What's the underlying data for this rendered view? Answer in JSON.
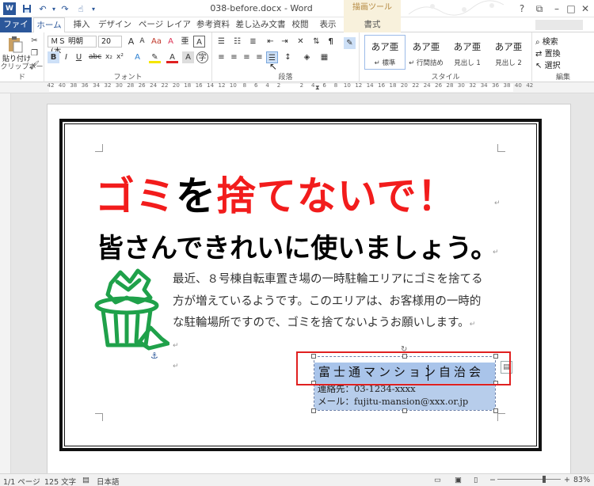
{
  "title_bar": {
    "doc_title": "038-before.docx - Word",
    "context_tab_group": "描画ツール",
    "quick_access": [
      "save-icon",
      "undo-icon",
      "redo-icon",
      "touch-mode-icon",
      "customize-icon"
    ],
    "window_buttons": [
      "?",
      "⧉",
      "–",
      "□",
      "✕"
    ]
  },
  "tabs": {
    "file": "ファイル",
    "home": "ホーム",
    "insert": "挿入",
    "design": "デザイン",
    "page_layout": "ページ レイアウト",
    "references": "参考資料",
    "mailings": "差し込み文書",
    "review": "校閲",
    "view": "表示",
    "format": "書式"
  },
  "ribbon": {
    "clipboard": {
      "paste": "貼り付け",
      "label": "クリップボード"
    },
    "font": {
      "name": "ＭＳ 明朝 (本",
      "size": "20",
      "label": "フォント"
    },
    "paragraph": {
      "label": "段落"
    },
    "styles": {
      "label": "スタイル",
      "items": [
        {
          "sample": "あア亜",
          "name": "↵ 標準"
        },
        {
          "sample": "あア亜",
          "name": "↵ 行間詰め"
        },
        {
          "sample": "あア亜",
          "name": "見出し 1"
        },
        {
          "sample": "あア亜",
          "name": "見出し 2"
        }
      ]
    },
    "editing": {
      "find": "検索",
      "replace": "置換",
      "select": "選択",
      "label": "編集"
    }
  },
  "ruler": {
    "numbers": [
      "42",
      "40",
      "38",
      "36",
      "34",
      "32",
      "30",
      "28",
      "26",
      "24",
      "22",
      "20",
      "18",
      "16",
      "14",
      "12",
      "10",
      "8",
      "6",
      "4",
      "2",
      "",
      "2",
      "4",
      "6",
      "8",
      "10",
      "12",
      "14",
      "16",
      "18",
      "20",
      "22",
      "24",
      "26",
      "28",
      "30",
      "32",
      "34",
      "36",
      "38",
      "40",
      "42"
    ]
  },
  "document": {
    "heading1_parts": [
      {
        "text": "ゴミ",
        "color": "#f21c1c"
      },
      {
        "text": "を",
        "color": "#000000"
      },
      {
        "text": "捨てないで！",
        "color": "#f21c1c"
      }
    ],
    "heading2": "皆さんできれいに使いましょう。",
    "body_lines": [
      "最近、８号棟自転車置き場の一時駐輪エリアにゴミを捨てる",
      "方が増えているようです。このエリアは、お客様用の一時的",
      "な駐輪場所ですので、ゴミを捨てないようお願いします。"
    ],
    "textbox": {
      "title": "富士通マンション自治会",
      "contact": "連絡先：03-1234-xxxx",
      "email": "メール：fujitu-mansion@xxx.or.jp"
    },
    "paragraph_mark": "↵",
    "anchor_icon": "anchor-icon"
  },
  "status_bar": {
    "page": "1/1 ページ",
    "words": "125 文字",
    "language": "日本語",
    "zoom": "83%",
    "zoom_fraction": 0.83
  },
  "colors": {
    "accent": "#2b579a",
    "heading_red": "#f21c1c",
    "selection": "#a9c4ea",
    "highlight_box": "#e02020",
    "trash_green": "#1fa14a"
  }
}
